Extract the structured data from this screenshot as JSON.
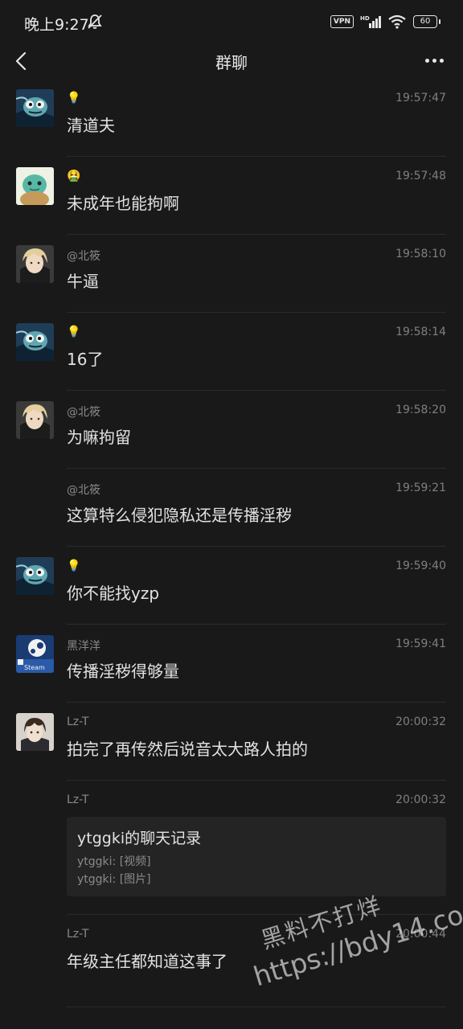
{
  "status_bar": {
    "time": "晚上9:27",
    "vpn": "VPN",
    "hd": "HD",
    "battery": "60"
  },
  "nav": {
    "title": "群聊"
  },
  "messages": [
    {
      "sender": "💡",
      "time": "19:57:47",
      "text": "清道夫",
      "avatar": "frog-cartoon-avatar"
    },
    {
      "sender": "🤮",
      "time": "19:57:48",
      "text": "未成年也能拘啊",
      "avatar": "squirtle-avatar"
    },
    {
      "sender": "@北筱",
      "time": "19:58:10",
      "text": "牛逼",
      "avatar": "blonde-anime-avatar"
    },
    {
      "sender": "💡",
      "time": "19:58:14",
      "text": "16了",
      "avatar": "frog-cartoon-avatar"
    },
    {
      "sender": "@北筱",
      "time": "19:58:20",
      "text": "为嘛拘留",
      "avatar": "blonde-anime-avatar"
    },
    {
      "sender": "@北筱",
      "time": "19:59:21",
      "text": "这算特么侵犯隐私还是传播淫秽",
      "avatar": ""
    },
    {
      "sender": "💡",
      "time": "19:59:40",
      "text": "你不能找yzp",
      "avatar": "frog-cartoon-avatar"
    },
    {
      "sender": "黑洋洋",
      "time": "19:59:41",
      "text": "传播淫秽得够量",
      "avatar": "steam-avatar",
      "avatar_label": "Steam"
    },
    {
      "sender": "Lz-T",
      "time": "20:00:32",
      "text": "拍完了再传然后说音太大路人拍的",
      "avatar": "dark-hair-anime-avatar"
    },
    {
      "sender": "Lz-T",
      "time": "20:00:32",
      "avatar": "",
      "record": {
        "title": "ytggki的聊天记录",
        "line1": "ytggki: [视频]",
        "line2": "ytggki: [图片]"
      }
    },
    {
      "sender": "Lz-T",
      "time": "20:00:44",
      "text": "年级主任都知道这事了",
      "avatar": ""
    }
  ],
  "watermark": {
    "line1": "黑料不打烊",
    "line2": "https://bdy14.co"
  }
}
